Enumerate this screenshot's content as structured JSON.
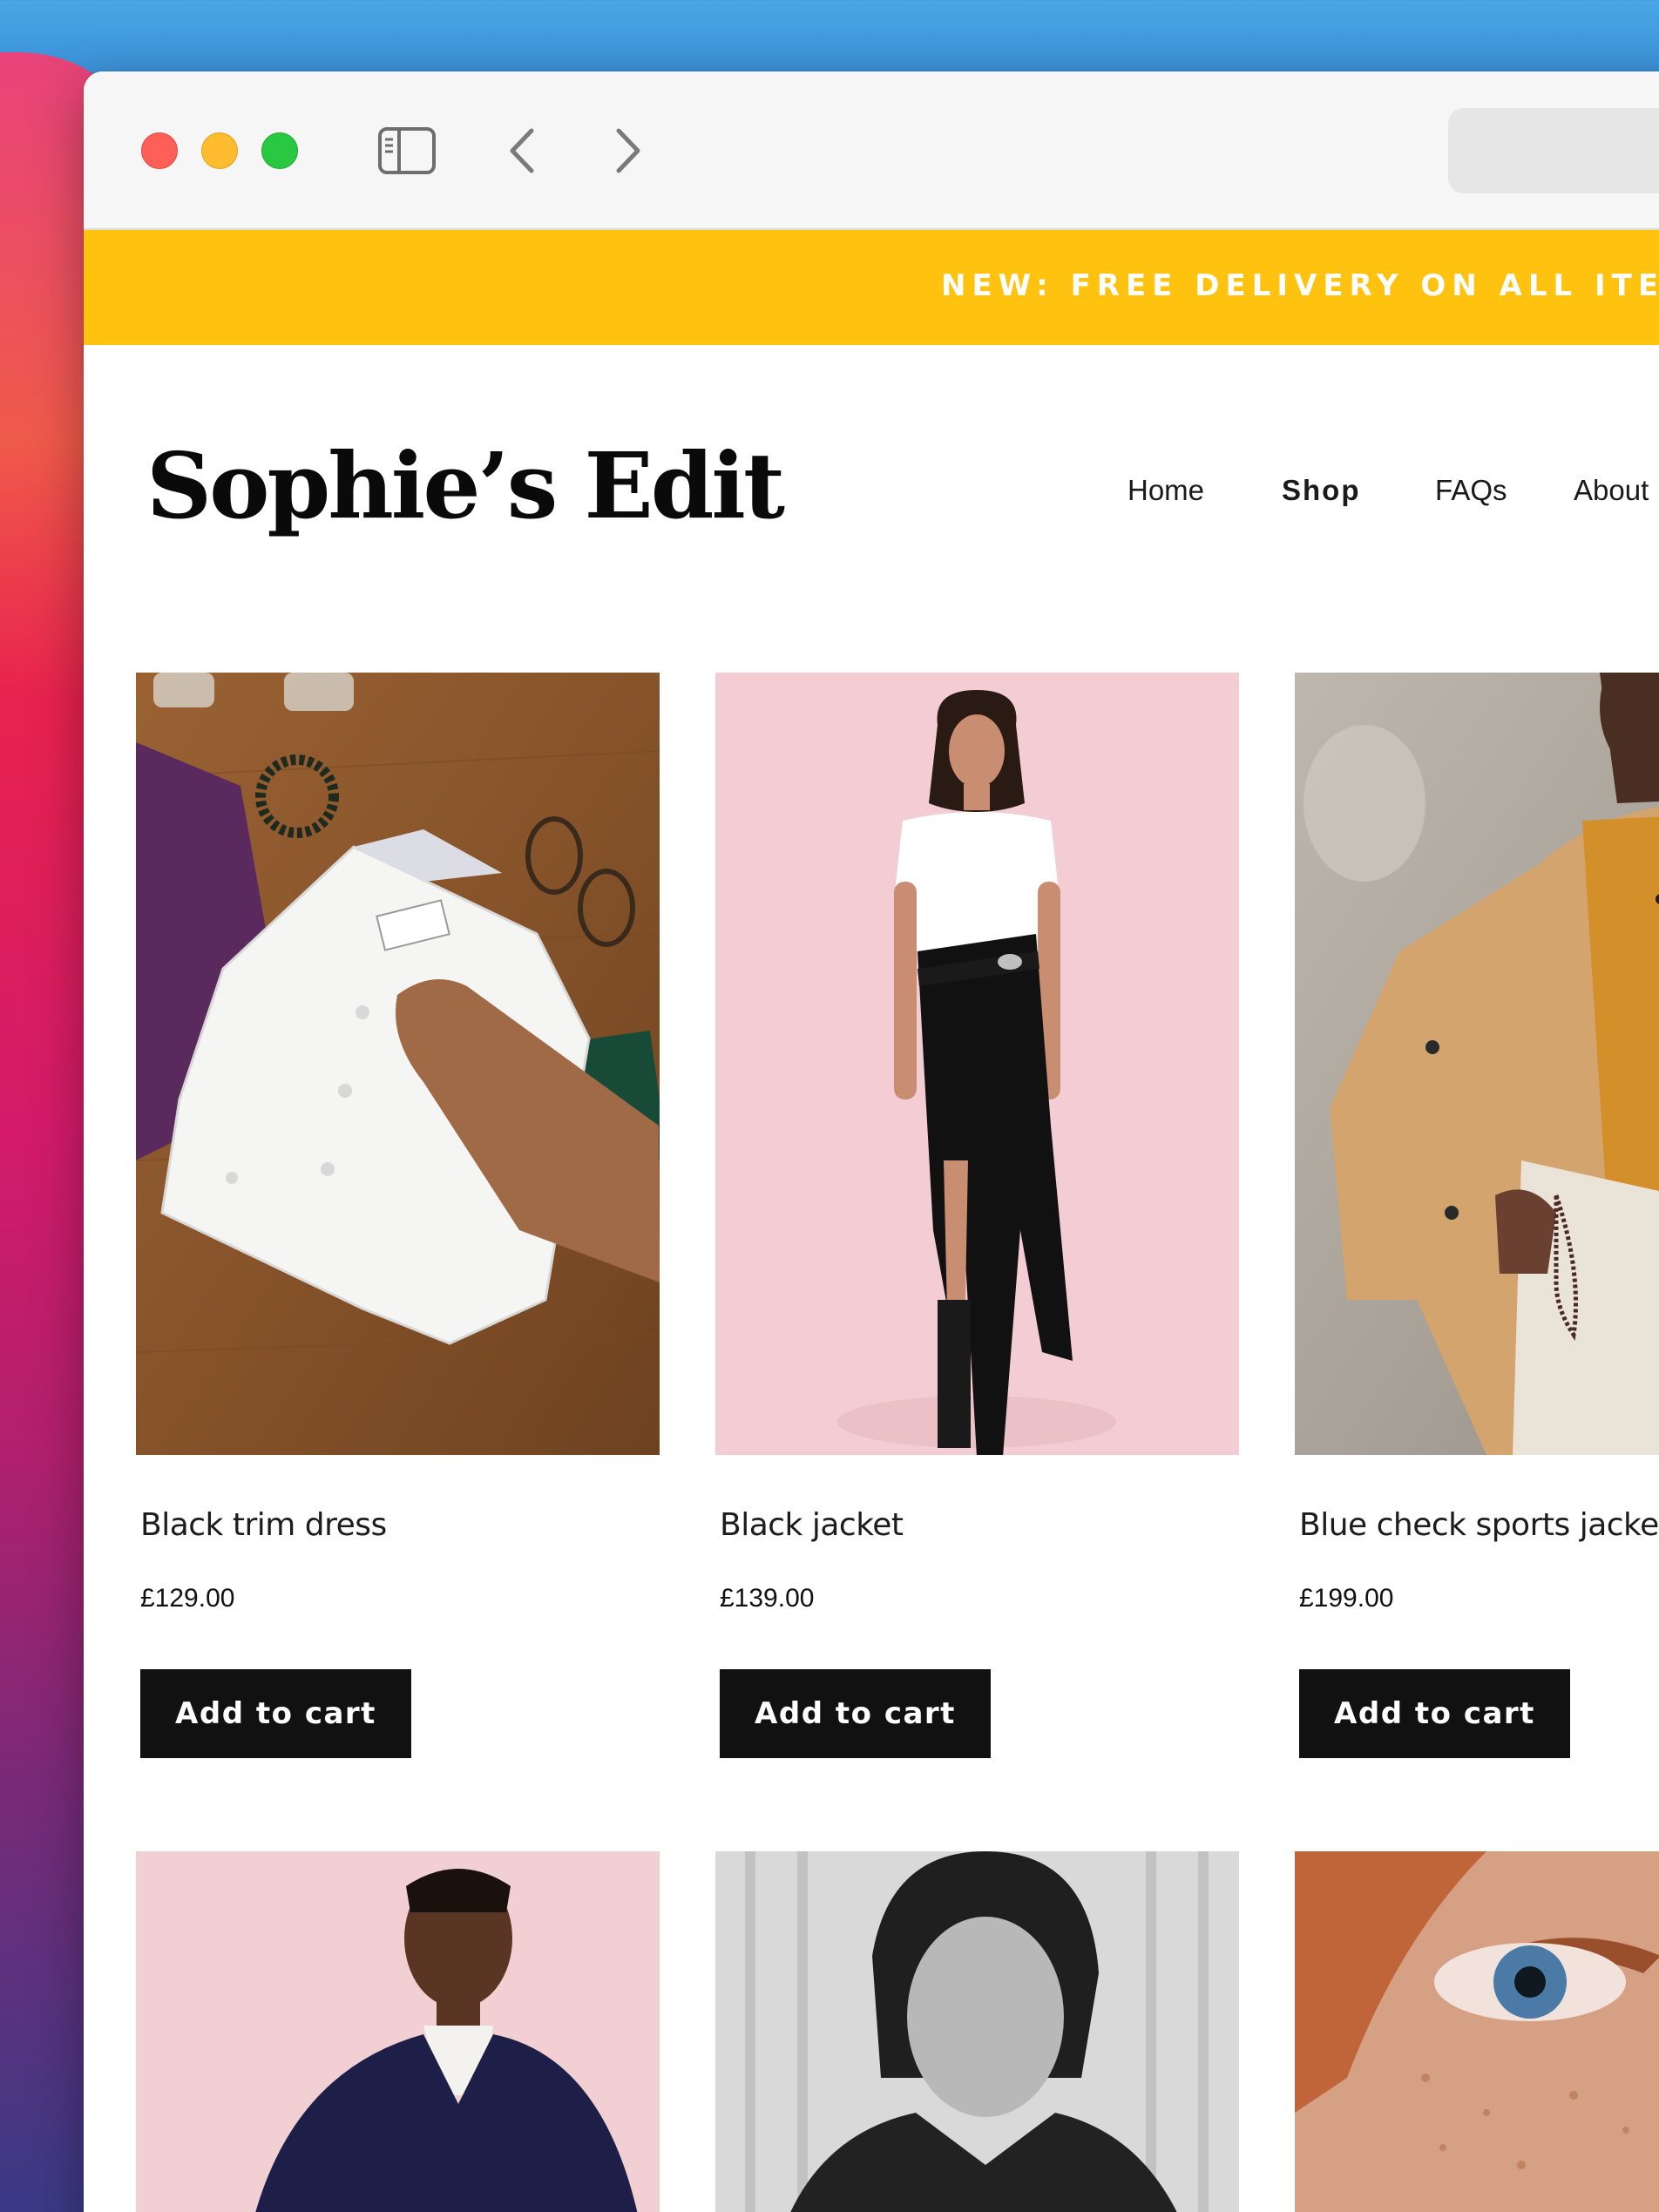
{
  "promo": {
    "text": "NEW: FREE DELIVERY ON ALL ITEMS"
  },
  "site": {
    "logo": "Sophie’s Edit"
  },
  "nav": {
    "home": "Home",
    "shop": "Shop",
    "faqs": "FAQs",
    "about": "About"
  },
  "products": [
    {
      "name": "Black trim dress",
      "price": "£129.00",
      "cta": "Add to cart"
    },
    {
      "name": "Black jacket",
      "price": "£139.00",
      "cta": "Add to cart"
    },
    {
      "name": "Blue check sports jacket",
      "price": "£199.00",
      "cta": "Add to cart"
    }
  ],
  "colors": {
    "promo_bg": "#ffc20e",
    "button_bg": "#111111",
    "accent_red": "#fe5f57",
    "accent_yellow": "#febc2e",
    "accent_green": "#28c840"
  },
  "icons": [
    "sidebar-toggle-icon",
    "back-chevron-icon",
    "forward-chevron-icon"
  ]
}
